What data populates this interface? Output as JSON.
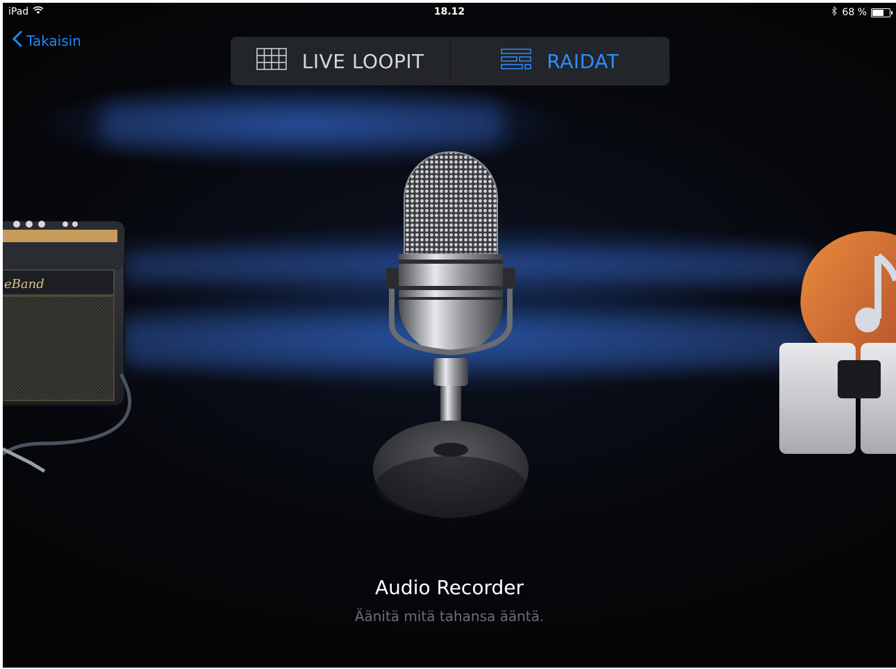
{
  "status_bar": {
    "device": "iPad",
    "time": "18.12",
    "battery_text": "68 %",
    "battery_level": 0.68
  },
  "nav": {
    "back_label": "Takaisin"
  },
  "segments": [
    {
      "label": "LIVE LOOPIT",
      "icon": "grid-icon",
      "active": false
    },
    {
      "label": "RAIDAT",
      "icon": "tracks-icon",
      "active": true
    }
  ],
  "amp": {
    "brand_text": "eBand"
  },
  "instrument": {
    "title": "Audio Recorder",
    "description": "Äänitä mitä tahansa ääntä."
  },
  "colors": {
    "accent": "#1f8bff",
    "background": "#07090f",
    "glow": "#2a62c4"
  }
}
